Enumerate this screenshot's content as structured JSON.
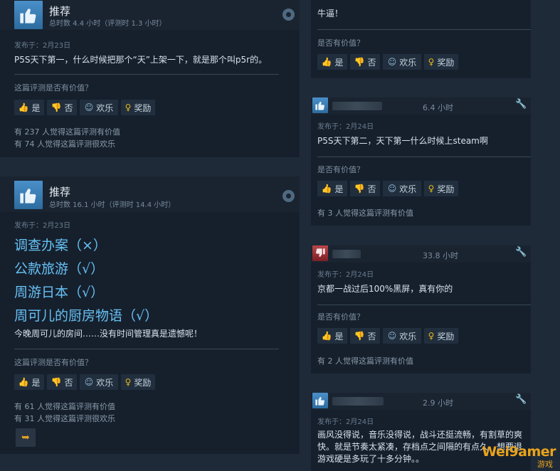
{
  "colors": {
    "page_bg": "#1f2a38",
    "card_bg": "#16202d",
    "link_blue": "#66c0f4",
    "award_gold": "#e6b81a",
    "thumb_down": "#b9464b"
  },
  "left_review_1": {
    "title": "推荐",
    "hours": "总时数 4.4 小时（评测时 1.3 小时）",
    "date": "发布于：2月23日",
    "text": "P5S天下第一，什么时候把那个“天”上架一下，就是那个叫p5r的。",
    "question": "这篇评测是否有价值？",
    "btn_yes": "是",
    "btn_no": "否",
    "btn_fun": "欢乐",
    "btn_award": "奖励",
    "stat_helpful": "有 237 人觉得这篇评测有价值",
    "stat_funny": "有 74 人觉得这篇评测很欢乐"
  },
  "left_review_2": {
    "title": "推荐",
    "hours": "总时数 16.1 小时（评测时 14.4 小时）",
    "date": "发布于：2月23日",
    "lines": [
      "调查办案（×）",
      "公款旅游（√）",
      "周游日本（√）",
      "周可儿的厨房物语（√）"
    ],
    "text": "今晚周可儿的房间……没有时间管理真是遗憾呢！",
    "question": "这篇评测是否有价值？",
    "btn_yes": "是",
    "btn_no": "否",
    "btn_fun": "欢乐",
    "btn_award": "奖励",
    "stat_helpful": "有 61 人觉得这篇评测有价值",
    "stat_funny": "有 31 人觉得这篇评测很欢乐"
  },
  "right_review_0": {
    "text": "牛逼！",
    "question": "是否有价值？",
    "btn_yes": "是",
    "btn_no": "否",
    "btn_fun": "欢乐",
    "btn_award": "奖励"
  },
  "right_review_1": {
    "hours": "6.4 小时",
    "date": "发布于：2月24日",
    "text": "P5S天下第二，天下第一什么时候上steam啊",
    "question": "是否有价值？",
    "btn_yes": "是",
    "btn_no": "否",
    "btn_fun": "欢乐",
    "btn_award": "奖励",
    "stat": "有 3 人觉得这篇评测有价值"
  },
  "right_review_2": {
    "hours": "33.8 小时",
    "date": "发布于：2月24日",
    "text": "京都一战过后100%黑屏，真有你的",
    "question": "是否有价值？",
    "btn_yes": "是",
    "btn_no": "否",
    "btn_fun": "欢乐",
    "btn_award": "奖励",
    "stat": "有 2 人觉得这篇评测有价值"
  },
  "right_review_3": {
    "hours": "2.9 小时",
    "date": "发布于：2月24日",
    "text": "画风没得说，音乐没得说，战斗还挺流畅，有割草的爽快。就是节奏太紧凑，存档点之间隔的有点久，想要退游戏硬是多玩了十多分钟。。"
  },
  "watermark": {
    "main": "Wei9amer",
    "sub": "游戏"
  }
}
